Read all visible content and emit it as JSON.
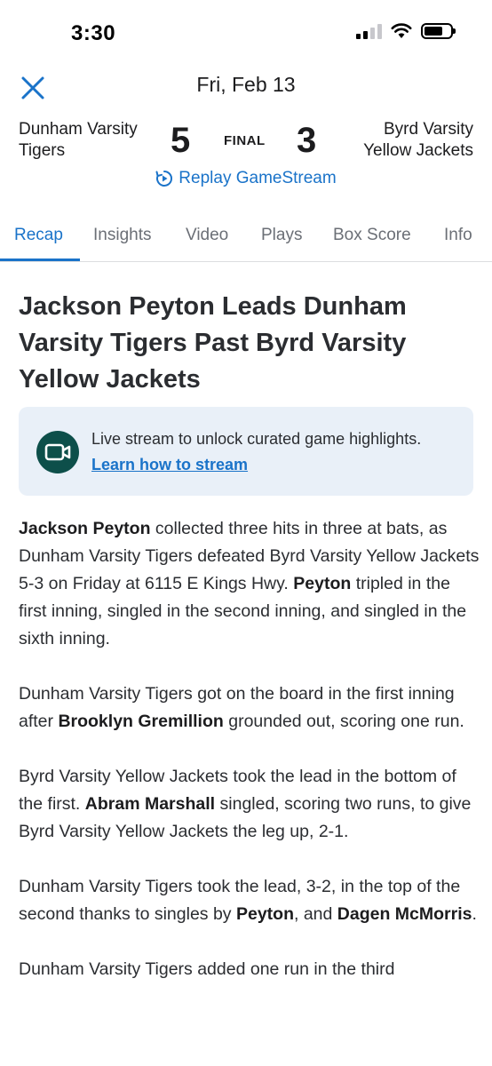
{
  "status": {
    "time": "3:30"
  },
  "header": {
    "date": "Fri, Feb 13"
  },
  "game": {
    "home_team_line1": "Dunham Varsity",
    "home_team_line2": "Tigers",
    "home_score": "5",
    "status": "FINAL",
    "away_score": "3",
    "away_team_line1": "Byrd Varsity",
    "away_team_line2": "Yellow Jackets",
    "replay_label": "Replay GameStream"
  },
  "tabs": [
    "Recap",
    "Insights",
    "Video",
    "Plays",
    "Box Score",
    "Info"
  ],
  "active_tab": "Recap",
  "recap": {
    "headline": "Jackson Peyton Leads Dunham Varsity Tigers Past Byrd Varsity Yellow Jackets",
    "banner_text": "Live stream to unlock curated game highlights.",
    "banner_link": "Learn how to stream",
    "p1": {
      "b1": "Jackson Peyton",
      "t1": " collected three hits in three at bats, as Dunham Varsity Tigers defeated Byrd Varsity Yellow Jackets 5-3 on Friday at 6115 E Kings Hwy. ",
      "b2": "Peyton",
      "t2": " tripled in the first inning, singled in the second inning, and singled in the sixth inning."
    },
    "p2": {
      "t1": "Dunham Varsity Tigers got on the board in the first inning after ",
      "b1": "Brooklyn Gremillion",
      "t2": " grounded out, scoring one run."
    },
    "p3": {
      "t1": "Byrd Varsity Yellow Jackets took the lead in the bottom of the first. ",
      "b1": "Abram Marshall",
      "t2": " singled, scoring two runs, to give Byrd Varsity Yellow Jackets the leg up, 2-1."
    },
    "p4": {
      "t1": "Dunham Varsity Tigers took the lead, 3-2, in the top of the second thanks to singles by ",
      "b1": "Peyton",
      "t2": ", and ",
      "b2": "Dagen McMorris",
      "t3": "."
    },
    "p5": {
      "t1": "Dunham Varsity Tigers added one run in the third"
    }
  },
  "colors": {
    "accent": "#1a73c9",
    "banner_bg": "#e9f0f8",
    "icon_bg": "#0d4f4a"
  }
}
